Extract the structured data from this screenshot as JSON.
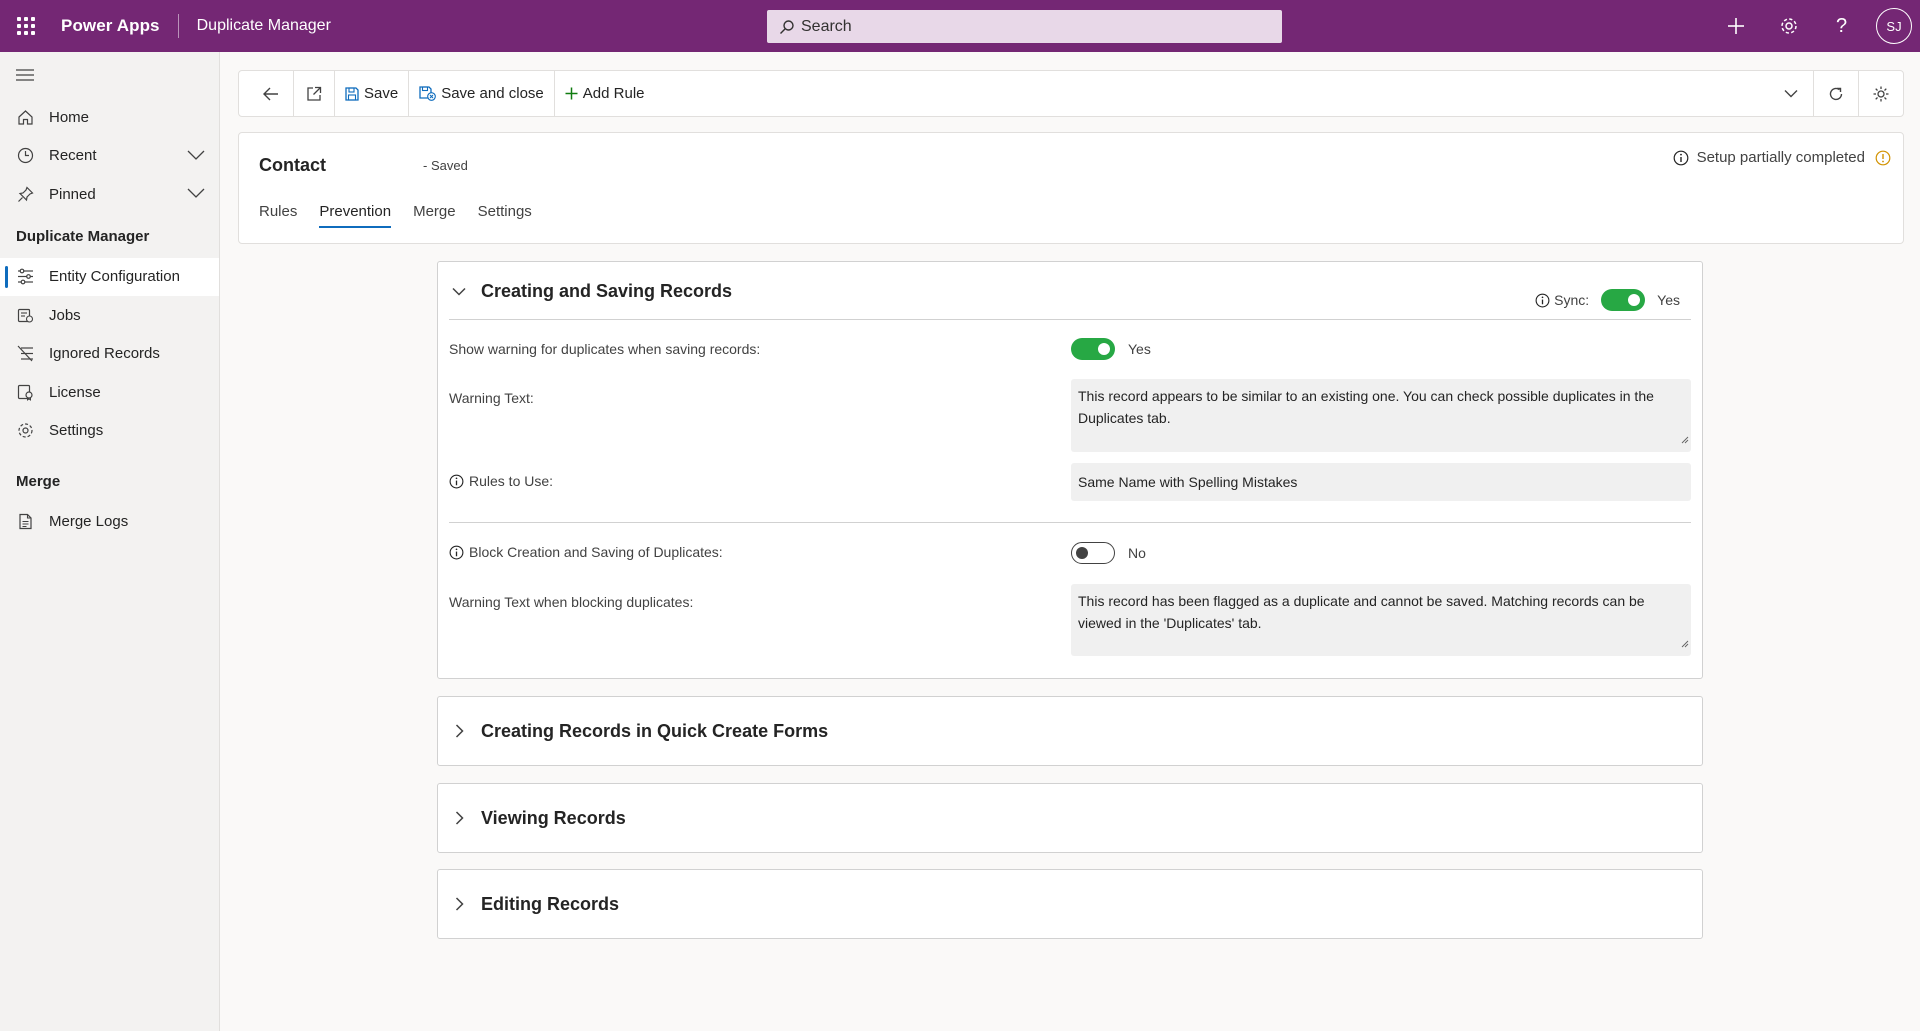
{
  "topbar": {
    "app_name": "Power Apps",
    "env_name": "Duplicate Manager",
    "search_placeholder": "Search",
    "avatar_initials": "SJ"
  },
  "sidebar": {
    "items_top": [
      {
        "label": "Home",
        "icon": "home-icon"
      },
      {
        "label": "Recent",
        "icon": "clock-icon"
      },
      {
        "label": "Pinned",
        "icon": "pin-icon"
      }
    ],
    "section1": "Duplicate Manager",
    "items_dm": [
      {
        "label": "Entity Configuration",
        "icon": "sliders-icon"
      },
      {
        "label": "Jobs",
        "icon": "jobs-icon"
      },
      {
        "label": "Ignored Records",
        "icon": "ignored-icon"
      },
      {
        "label": "License",
        "icon": "license-icon"
      },
      {
        "label": "Settings",
        "icon": "gear-icon"
      }
    ],
    "section2": "Merge",
    "items_merge": [
      {
        "label": "Merge Logs",
        "icon": "document-icon"
      }
    ]
  },
  "cmdbar": {
    "save": "Save",
    "save_close": "Save and close",
    "add_rule": "Add Rule"
  },
  "header": {
    "title": "Contact",
    "status": "- Saved",
    "setup_status": "Setup partially completed",
    "tabs": [
      "Rules",
      "Prevention",
      "Merge",
      "Settings"
    ],
    "active_tab": "Prevention"
  },
  "panels": {
    "creating_saving": {
      "title": "Creating and Saving Records",
      "sync_label": "Sync:",
      "sync_value": "Yes",
      "show_warning_label": "Show warning for duplicates when saving records:",
      "show_warning_value": "Yes",
      "warning_text_label": "Warning Text:",
      "warning_text": "This record appears to be similar to an existing one. You can check possible duplicates in the Duplicates tab.",
      "rules_label": "Rules to Use:",
      "rules_value": "Same Name with Spelling Mistakes",
      "block_label": "Block Creation and Saving of Duplicates:",
      "block_value": "No",
      "block_text_label": "Warning Text when blocking duplicates:",
      "block_text": "This record has been flagged as a duplicate and cannot be saved. Matching records can be viewed in the 'Duplicates' tab."
    },
    "quick_create": {
      "title": "Creating Records in Quick Create Forms"
    },
    "viewing": {
      "title": "Viewing Records"
    },
    "editing": {
      "title": "Editing Records"
    }
  },
  "colors": {
    "brand": "#742774",
    "toggle_on": "#27a844",
    "accent": "#0f6cbd"
  }
}
